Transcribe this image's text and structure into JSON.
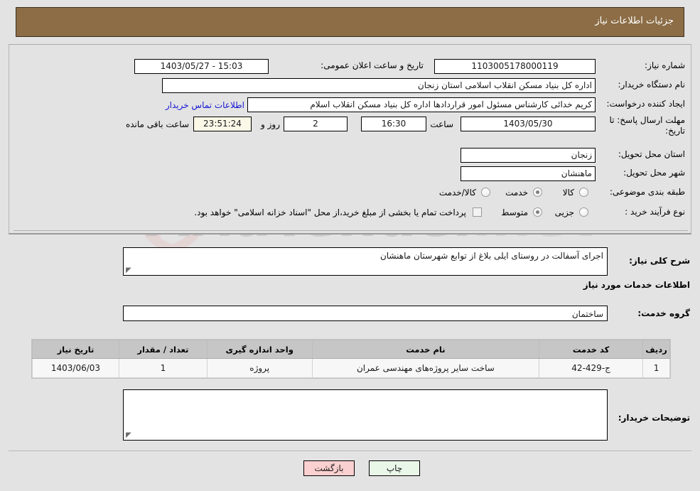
{
  "header": {
    "title": "جزئیات اطلاعات نیاز"
  },
  "form": {
    "need_number_label": "شماره نیاز:",
    "need_number_value": "1103005178000119",
    "announce_datetime_label": "تاریخ و ساعت اعلان عمومی:",
    "announce_datetime_value": "15:03 - 1403/05/27",
    "buyer_org_label": "نام دستگاه خریدار:",
    "buyer_org_value": "اداره کل بنیاد مسکن انقلاب اسلامی استان زنجان",
    "requester_label": "ایجاد کننده درخواست:",
    "requester_value": "کریم خدائی کارشناس مسئول امور قراردادها اداره کل بنیاد مسکن انقلاب اسلام",
    "contact_link": "اطلاعات تماس خریدار",
    "deadline_label_line1": "مهلت ارسال پاسخ: تا",
    "deadline_label_line2": "تاریخ:",
    "deadline_date": "1403/05/30",
    "deadline_hour_label": "ساعت",
    "deadline_hour": "16:30",
    "remaining_days": "2",
    "remaining_days_label": "روز و",
    "remaining_time": "23:51:24",
    "remaining_time_label": "ساعت باقی مانده",
    "province_label": "استان محل تحویل:",
    "province_value": "زنجان",
    "city_label": "شهر محل تحویل:",
    "city_value": "ماهنشان",
    "category_label": "طبقه بندی موضوعی:",
    "category_options": [
      {
        "label": "کالا",
        "selected": false
      },
      {
        "label": "خدمت",
        "selected": true
      },
      {
        "label": "کالا/خدمت",
        "selected": false
      }
    ],
    "process_type_label": "نوع فرآیند خرید :",
    "process_type_options": [
      {
        "label": "جزیی",
        "selected": false
      },
      {
        "label": "متوسط",
        "selected": true
      }
    ],
    "treasury_note": "پرداخت تمام یا بخشی از مبلغ خرید،از محل \"اسناد خزانه اسلامی\" خواهد بود."
  },
  "description": {
    "label": "شرح کلی نیاز:",
    "value": "اجرای آسفالت در روستای  ایلی بلاغ از توابع شهرستان ماهنشان"
  },
  "services": {
    "section_title": "اطلاعات خدمات مورد نیاز",
    "group_label": "گروه خدمت:",
    "group_value": "ساختمان",
    "columns": [
      "ردیف",
      "کد خدمت",
      "نام خدمت",
      "واحد اندازه گیری",
      "تعداد / مقدار",
      "تاریخ نیاز"
    ],
    "rows": [
      {
        "index": "1",
        "code": "ج-429-42",
        "name": "ساخت سایر پروژه‌های مهندسی عمران",
        "unit": "پروژه",
        "quantity": "1",
        "need_date": "1403/06/03"
      }
    ]
  },
  "buyer_comments": {
    "label": "توضیحات خریدار:",
    "value": ""
  },
  "footer": {
    "print_label": "چاپ",
    "back_label": "بازگشت"
  },
  "watermark": {
    "text_left": "AriaTender",
    "text_right": ".net"
  },
  "colors": {
    "header_bg": "#8c6d46",
    "link": "#1414d4",
    "print_btn": "#e9f7e9",
    "back_btn": "#fbd0d0",
    "countdown_bg": "#fbf8e8"
  }
}
